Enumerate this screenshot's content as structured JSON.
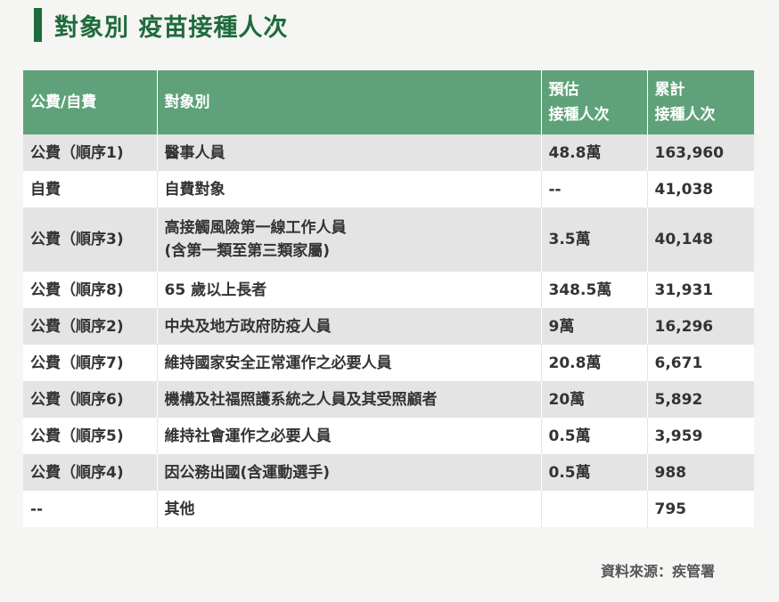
{
  "title": "對象別 疫苗接種人次",
  "headers": {
    "col1": "公費/自費",
    "col2": "對象別",
    "col3_line1": "預估",
    "col3_line2": "接種人次",
    "col4_line1": "累計",
    "col4_line2": "接種人次"
  },
  "rows": [
    {
      "type": "公費（順序1)",
      "target": "醫事人員",
      "target2": "",
      "estimate": "48.8萬",
      "total": "163,960"
    },
    {
      "type": "自費",
      "target": "自費對象",
      "target2": "",
      "estimate": "--",
      "total": "41,038"
    },
    {
      "type": "公費（順序3)",
      "target": "高接觸風險第一線工作人員",
      "target2": "(含第一類至第三類家屬)",
      "estimate": "3.5萬",
      "total": "40,148"
    },
    {
      "type": "公費（順序8)",
      "target": "65 歲以上長者",
      "target2": "",
      "estimate": "348.5萬",
      "total": "31,931"
    },
    {
      "type": "公費（順序2)",
      "target": "中央及地方政府防疫人員",
      "target2": "",
      "estimate": "9萬",
      "total": "16,296"
    },
    {
      "type": "公費（順序7)",
      "target": "維持國家安全正常運作之必要人員",
      "target2": "",
      "estimate": "20.8萬",
      "total": "6,671"
    },
    {
      "type": "公費（順序6)",
      "target": "機構及社福照護系統之人員及其受照顧者",
      "target2": "",
      "estimate": "20萬",
      "total": "5,892"
    },
    {
      "type": "公費（順序5)",
      "target": "維持社會運作之必要人員",
      "target2": "",
      "estimate": "0.5萬",
      "total": "3,959"
    },
    {
      "type": "公費（順序4)",
      "target": "因公務出國(含運動選手)",
      "target2": "",
      "estimate": "0.5萬",
      "total": "988"
    },
    {
      "type": "--",
      "target": "其他",
      "target2": "",
      "estimate": "",
      "total": "795"
    }
  ],
  "source": "資料來源：疾管署",
  "colors": {
    "title": "#1f6b3d",
    "header_bg": "#5fa27a",
    "row_alt_bg": "#e4e4e4"
  }
}
